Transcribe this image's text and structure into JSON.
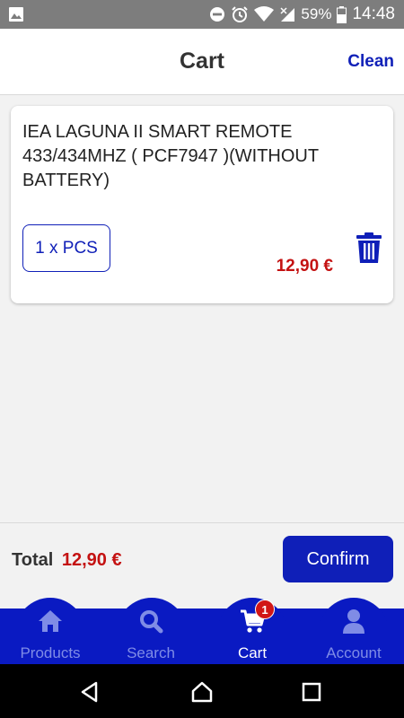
{
  "status_bar": {
    "battery": "59%",
    "time": "14:48",
    "icons": [
      "image-icon",
      "dnd-icon",
      "alarm-icon",
      "wifi-icon",
      "signal-icon",
      "battery-icon"
    ]
  },
  "header": {
    "title": "Cart",
    "clean_label": "Clean"
  },
  "cart": {
    "items": [
      {
        "name": "IEA LAGUNA II SMART REMOTE 433/434MHZ ( PCF7947 )(WITHOUT BATTERY)",
        "quantity_label": "1 x PCS",
        "price": "12,90 €"
      }
    ]
  },
  "summary": {
    "total_label": "Total",
    "total_value": "12,90 €",
    "confirm_label": "Confirm"
  },
  "tabs": [
    {
      "label": "Products",
      "icon": "home-icon",
      "active": false
    },
    {
      "label": "Search",
      "icon": "search-icon",
      "active": false
    },
    {
      "label": "Cart",
      "icon": "cart-icon",
      "active": true,
      "badge": "1"
    },
    {
      "label": "Account",
      "icon": "user-icon",
      "active": false
    }
  ],
  "colors": {
    "accent": "#0f1fb8",
    "price": "#c41212",
    "status_bar": "#7d7d7d"
  }
}
